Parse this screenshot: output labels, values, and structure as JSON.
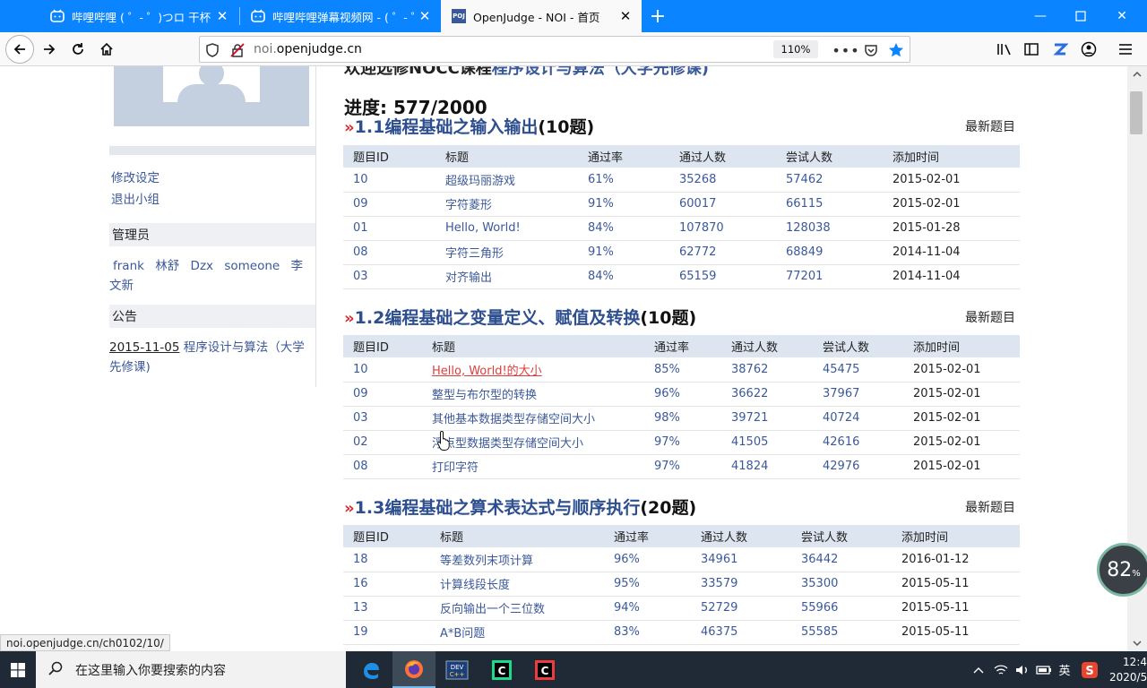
{
  "browser": {
    "tabs": [
      {
        "title": "哔哩哔哩 ( ゜- ゜)つロ 干杯~-bi"
      },
      {
        "title": "哔哩哔哩弹幕视频网 - ( ゜- ゜)"
      },
      {
        "title": "OpenJudge - NOI - 首页",
        "favicon": "POJ"
      }
    ],
    "url_prefix": "noi.",
    "url_domain": "openjudge.cn",
    "zoom": "110%",
    "status_url": "noi.openjudge.cn/ch0102/10/"
  },
  "sidebar": {
    "links": [
      "修改设定",
      "退出小组"
    ],
    "admin_title": "管理员",
    "admins": [
      "frank",
      "林舒",
      "Dzx",
      "someone",
      "李文新"
    ],
    "notice_title": "公告",
    "notice_date": "2015-11-05",
    "notice_text": " 程序设计与算法（大学先修课)"
  },
  "main": {
    "welcome_prefix": "欢迎选修NOCC课程",
    "welcome_link": "程序设计与算法（大学先修课)",
    "progress": "进度: 577/2000",
    "latest_label": "最新题目",
    "columns": [
      "题目ID",
      "标题",
      "通过率",
      "通过人数",
      "尝试人数",
      "添加时间"
    ],
    "sections": [
      {
        "number": "1.1",
        "name": "编程基础之输入输出",
        "count": "(10题)",
        "rows": [
          [
            "10",
            "超级玛丽游戏",
            "61%",
            "35268",
            "57462",
            "2015-02-01"
          ],
          [
            "09",
            "字符菱形",
            "91%",
            "60017",
            "66115",
            "2015-02-01"
          ],
          [
            "01",
            "Hello, World!",
            "84%",
            "107870",
            "128038",
            "2015-01-28"
          ],
          [
            "08",
            "字符三角形",
            "91%",
            "62772",
            "68849",
            "2014-11-04"
          ],
          [
            "03",
            "对齐输出",
            "84%",
            "65159",
            "77201",
            "2014-11-04"
          ]
        ]
      },
      {
        "number": "1.2",
        "name": "编程基础之变量定义、赋值及转换",
        "count": "(10题)",
        "rows": [
          [
            "10",
            "Hello, World!的大小",
            "85%",
            "38762",
            "45475",
            "2015-02-01"
          ],
          [
            "09",
            "整型与布尔型的转换",
            "96%",
            "36622",
            "37967",
            "2015-02-01"
          ],
          [
            "03",
            "其他基本数据类型存储空间大小",
            "98%",
            "39721",
            "40724",
            "2015-02-01"
          ],
          [
            "02",
            "浮点型数据类型存储空间大小",
            "97%",
            "41505",
            "42616",
            "2015-02-01"
          ],
          [
            "08",
            "打印字符",
            "97%",
            "41824",
            "42976",
            "2015-02-01"
          ]
        ]
      },
      {
        "number": "1.3",
        "name": "编程基础之算术表达式与顺序执行",
        "count": "(20题)",
        "rows": [
          [
            "18",
            "等差数列末项计算",
            "96%",
            "34961",
            "36442",
            "2016-01-12"
          ],
          [
            "16",
            "计算线段长度",
            "95%",
            "33579",
            "35300",
            "2015-05-11"
          ],
          [
            "13",
            "反向输出一个三位数",
            "94%",
            "52729",
            "55966",
            "2015-05-11"
          ],
          [
            "19",
            "A*B问题",
            "83%",
            "46375",
            "55585",
            "2015-05-11"
          ]
        ]
      }
    ]
  },
  "overlay": {
    "zoom_widget_value": "82",
    "zoom_widget_unit": "%"
  },
  "taskbar": {
    "search_placeholder": "在这里输入你要搜索的内容",
    "ime": "英",
    "time": "12:4",
    "date": "2020/5"
  },
  "colors": {
    "tabbar": "#0a84ff",
    "link": "#3b5998",
    "section_title": "#2d4e8f",
    "hover_link": "#e03c3c",
    "table_header": "#dde6f0"
  }
}
